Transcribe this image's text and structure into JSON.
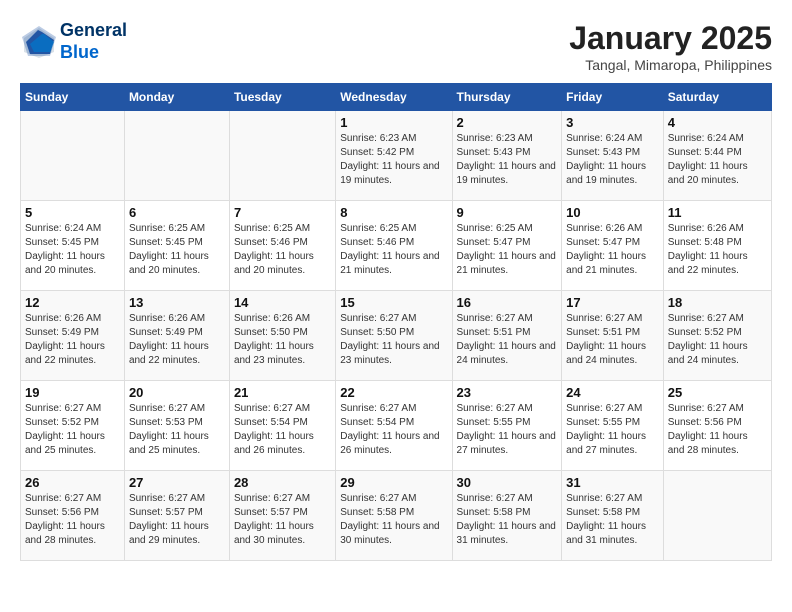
{
  "header": {
    "logo_line1": "General",
    "logo_line2": "Blue",
    "title": "January 2025",
    "subtitle": "Tangal, Mimaropa, Philippines"
  },
  "calendar": {
    "weekdays": [
      "Sunday",
      "Monday",
      "Tuesday",
      "Wednesday",
      "Thursday",
      "Friday",
      "Saturday"
    ],
    "weeks": [
      [
        {
          "day": "",
          "info": ""
        },
        {
          "day": "",
          "info": ""
        },
        {
          "day": "",
          "info": ""
        },
        {
          "day": "1",
          "info": "Sunrise: 6:23 AM\nSunset: 5:42 PM\nDaylight: 11 hours and 19 minutes."
        },
        {
          "day": "2",
          "info": "Sunrise: 6:23 AM\nSunset: 5:43 PM\nDaylight: 11 hours and 19 minutes."
        },
        {
          "day": "3",
          "info": "Sunrise: 6:24 AM\nSunset: 5:43 PM\nDaylight: 11 hours and 19 minutes."
        },
        {
          "day": "4",
          "info": "Sunrise: 6:24 AM\nSunset: 5:44 PM\nDaylight: 11 hours and 20 minutes."
        }
      ],
      [
        {
          "day": "5",
          "info": "Sunrise: 6:24 AM\nSunset: 5:45 PM\nDaylight: 11 hours and 20 minutes."
        },
        {
          "day": "6",
          "info": "Sunrise: 6:25 AM\nSunset: 5:45 PM\nDaylight: 11 hours and 20 minutes."
        },
        {
          "day": "7",
          "info": "Sunrise: 6:25 AM\nSunset: 5:46 PM\nDaylight: 11 hours and 20 minutes."
        },
        {
          "day": "8",
          "info": "Sunrise: 6:25 AM\nSunset: 5:46 PM\nDaylight: 11 hours and 21 minutes."
        },
        {
          "day": "9",
          "info": "Sunrise: 6:25 AM\nSunset: 5:47 PM\nDaylight: 11 hours and 21 minutes."
        },
        {
          "day": "10",
          "info": "Sunrise: 6:26 AM\nSunset: 5:47 PM\nDaylight: 11 hours and 21 minutes."
        },
        {
          "day": "11",
          "info": "Sunrise: 6:26 AM\nSunset: 5:48 PM\nDaylight: 11 hours and 22 minutes."
        }
      ],
      [
        {
          "day": "12",
          "info": "Sunrise: 6:26 AM\nSunset: 5:49 PM\nDaylight: 11 hours and 22 minutes."
        },
        {
          "day": "13",
          "info": "Sunrise: 6:26 AM\nSunset: 5:49 PM\nDaylight: 11 hours and 22 minutes."
        },
        {
          "day": "14",
          "info": "Sunrise: 6:26 AM\nSunset: 5:50 PM\nDaylight: 11 hours and 23 minutes."
        },
        {
          "day": "15",
          "info": "Sunrise: 6:27 AM\nSunset: 5:50 PM\nDaylight: 11 hours and 23 minutes."
        },
        {
          "day": "16",
          "info": "Sunrise: 6:27 AM\nSunset: 5:51 PM\nDaylight: 11 hours and 24 minutes."
        },
        {
          "day": "17",
          "info": "Sunrise: 6:27 AM\nSunset: 5:51 PM\nDaylight: 11 hours and 24 minutes."
        },
        {
          "day": "18",
          "info": "Sunrise: 6:27 AM\nSunset: 5:52 PM\nDaylight: 11 hours and 24 minutes."
        }
      ],
      [
        {
          "day": "19",
          "info": "Sunrise: 6:27 AM\nSunset: 5:52 PM\nDaylight: 11 hours and 25 minutes."
        },
        {
          "day": "20",
          "info": "Sunrise: 6:27 AM\nSunset: 5:53 PM\nDaylight: 11 hours and 25 minutes."
        },
        {
          "day": "21",
          "info": "Sunrise: 6:27 AM\nSunset: 5:54 PM\nDaylight: 11 hours and 26 minutes."
        },
        {
          "day": "22",
          "info": "Sunrise: 6:27 AM\nSunset: 5:54 PM\nDaylight: 11 hours and 26 minutes."
        },
        {
          "day": "23",
          "info": "Sunrise: 6:27 AM\nSunset: 5:55 PM\nDaylight: 11 hours and 27 minutes."
        },
        {
          "day": "24",
          "info": "Sunrise: 6:27 AM\nSunset: 5:55 PM\nDaylight: 11 hours and 27 minutes."
        },
        {
          "day": "25",
          "info": "Sunrise: 6:27 AM\nSunset: 5:56 PM\nDaylight: 11 hours and 28 minutes."
        }
      ],
      [
        {
          "day": "26",
          "info": "Sunrise: 6:27 AM\nSunset: 5:56 PM\nDaylight: 11 hours and 28 minutes."
        },
        {
          "day": "27",
          "info": "Sunrise: 6:27 AM\nSunset: 5:57 PM\nDaylight: 11 hours and 29 minutes."
        },
        {
          "day": "28",
          "info": "Sunrise: 6:27 AM\nSunset: 5:57 PM\nDaylight: 11 hours and 30 minutes."
        },
        {
          "day": "29",
          "info": "Sunrise: 6:27 AM\nSunset: 5:58 PM\nDaylight: 11 hours and 30 minutes."
        },
        {
          "day": "30",
          "info": "Sunrise: 6:27 AM\nSunset: 5:58 PM\nDaylight: 11 hours and 31 minutes."
        },
        {
          "day": "31",
          "info": "Sunrise: 6:27 AM\nSunset: 5:58 PM\nDaylight: 11 hours and 31 minutes."
        },
        {
          "day": "",
          "info": ""
        }
      ]
    ]
  }
}
